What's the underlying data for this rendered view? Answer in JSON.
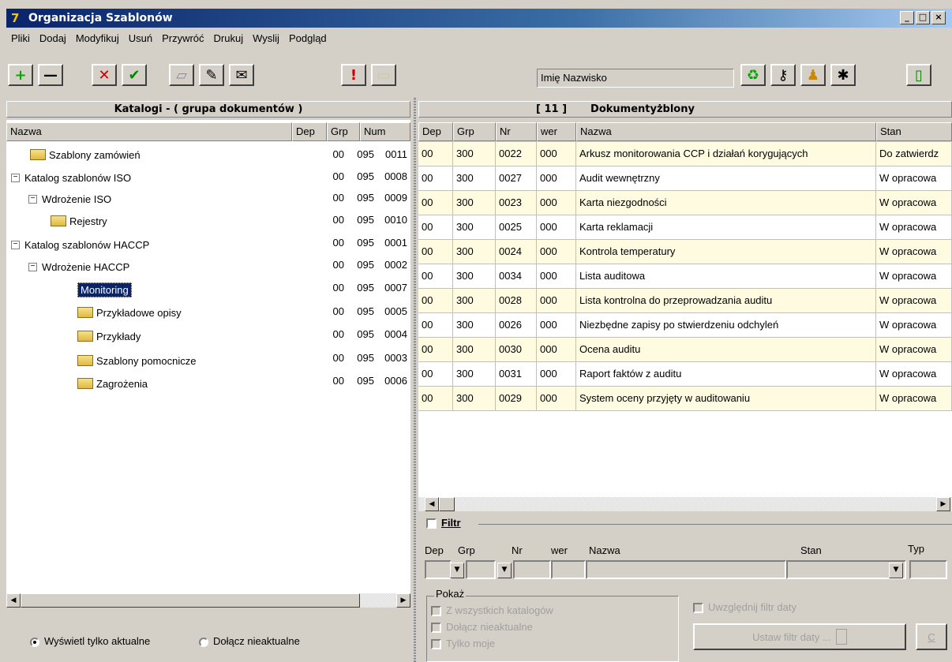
{
  "window": {
    "title": "Organizacja Szablonów"
  },
  "menu": [
    "Pliki",
    "Dodaj",
    "Modyfikuj",
    "Usuń",
    "Przywróć",
    "Drukuj",
    "Wyslij",
    "Podgląd"
  ],
  "toolbar": {
    "user_name": "Imię Nazwisko"
  },
  "left_panel": {
    "header": "Katalogi - ( grupa dokumentów )",
    "columns": [
      "Nazwa",
      "Dep",
      "Grp",
      "Num"
    ],
    "nodes": [
      {
        "label": "Szablony zamówień",
        "dep": "00",
        "grp": "095",
        "num": "0011"
      },
      {
        "label": "Katalog szablonów ISO",
        "dep": "00",
        "grp": "095",
        "num": "0008"
      },
      {
        "label": "Wdrożenie ISO",
        "dep": "00",
        "grp": "095",
        "num": "0009"
      },
      {
        "label": "Rejestry",
        "dep": "00",
        "grp": "095",
        "num": "0010"
      },
      {
        "label": "Katalog szablonów HACCP",
        "dep": "00",
        "grp": "095",
        "num": "0001"
      },
      {
        "label": "Wdrożenie HACCP",
        "dep": "00",
        "grp": "095",
        "num": "0002"
      },
      {
        "label": "Monitoring",
        "dep": "00",
        "grp": "095",
        "num": "0007"
      },
      {
        "label": "Przykładowe opisy",
        "dep": "00",
        "grp": "095",
        "num": "0005"
      },
      {
        "label": "Przykłady",
        "dep": "00",
        "grp": "095",
        "num": "0004"
      },
      {
        "label": "Szablony pomocnicze",
        "dep": "00",
        "grp": "095",
        "num": "0003"
      },
      {
        "label": "Zagrożenia",
        "dep": "00",
        "grp": "095",
        "num": "0006"
      }
    ],
    "radio_current": "Wyświetl tylko aktualne",
    "radio_include": "Dołącz nieaktualne"
  },
  "right_panel": {
    "count": "[ 11 ]",
    "header": "Dokumentyżblony",
    "columns": [
      "Dep",
      "Grp",
      "Nr",
      "wer",
      "Nazwa",
      "Stan"
    ],
    "rows": [
      [
        "00",
        "300",
        "0022",
        "000",
        "Arkusz monitorowania CCP i działań korygujących",
        "Do zatwierdz"
      ],
      [
        "00",
        "300",
        "0027",
        "000",
        "Audit wewnętrzny",
        "W opracowa"
      ],
      [
        "00",
        "300",
        "0023",
        "000",
        "Karta niezgodności",
        "W opracowa"
      ],
      [
        "00",
        "300",
        "0025",
        "000",
        "Karta reklamacji",
        "W opracowa"
      ],
      [
        "00",
        "300",
        "0024",
        "000",
        "Kontrola temperatury",
        "W opracowa"
      ],
      [
        "00",
        "300",
        "0034",
        "000",
        "Lista auditowa",
        "W opracowa"
      ],
      [
        "00",
        "300",
        "0028",
        "000",
        "Lista kontrolna do przeprowadzania auditu",
        "W opracowa"
      ],
      [
        "00",
        "300",
        "0026",
        "000",
        "Niezbędne zapisy po stwierdzeniu odchyleń",
        "W opracowa"
      ],
      [
        "00",
        "300",
        "0030",
        "000",
        "Ocena auditu",
        "W opracowa"
      ],
      [
        "00",
        "300",
        "0031",
        "000",
        "Raport faktów z auditu",
        "W opracowa"
      ],
      [
        "00",
        "300",
        "0029",
        "000",
        "System oceny przyjęty w auditowaniu",
        "W opracowa"
      ]
    ],
    "filter": {
      "title": "Filtr",
      "labels": [
        "Dep",
        "Grp",
        "Nr",
        "wer",
        "Nazwa",
        "Stan",
        "Typ"
      ],
      "show_group": "Pokaż",
      "show_all_catalogs": "Z wszystkich katalogów",
      "show_outdated": "Dołącz nieaktualne",
      "show_mine": "Tylko moje",
      "date_filter_check": "Uwzględnij filtr daty",
      "date_filter_button": "Ustaw filtr daty ...",
      "c_button": "C"
    }
  },
  "colors": {
    "title_start": "#0a246a",
    "highlight_row": "#fffbe0",
    "selection": "#0a246a"
  }
}
